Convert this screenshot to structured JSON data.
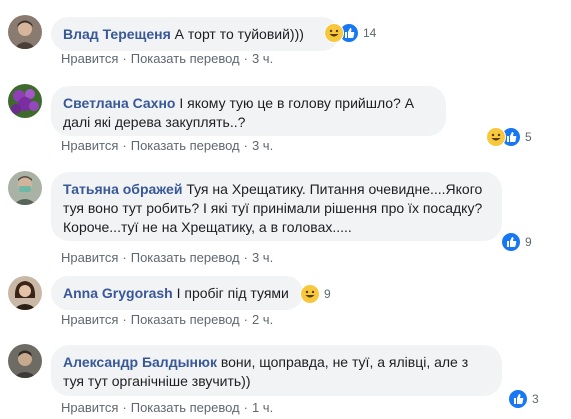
{
  "comments": [
    {
      "author": "Влад Терещеня",
      "text": "А торт то туйовий)))",
      "reaction_count": "14",
      "reactions": [
        "haha-icon",
        "like-icon"
      ],
      "actions": {
        "like": "Нравится",
        "translate": "Показать перевод",
        "time": "3 ч."
      }
    },
    {
      "author": "Светлана Сахно",
      "text": "І якому тую це в голову прийшло? А далі які дерева закуплять..?",
      "reaction_count": "5",
      "reactions": [
        "haha-icon",
        "like-icon"
      ],
      "actions": {
        "like": "Нравится",
        "translate": "Показать перевод",
        "time": "3 ч."
      }
    },
    {
      "author": "Татьяна ображей",
      "text": "Туя на Хрещатику. Питання очевидне....Якого туя воно тут робить? І які туї принімали рішення про їх посадку? Короче...туї не на Хрещатику, а в головах.....",
      "reaction_count": "9",
      "reactions": [
        "like-icon"
      ],
      "actions": {
        "like": "Нравится",
        "translate": "Показать перевод",
        "time": "3 ч."
      }
    },
    {
      "author": "Anna Grygorash",
      "text": "І пробіг під туями",
      "reaction_count": "9",
      "reactions": [
        "haha-icon"
      ],
      "actions": {
        "like": "Нравится",
        "translate": "Показать перевод",
        "time": "2 ч."
      }
    },
    {
      "author": "Александр Балдынюк",
      "text": "вони, щоправда, не туї, а ялівці, але з туя тут органічніше звучить))",
      "reaction_count": "3",
      "reactions": [
        "like-icon"
      ],
      "actions": {
        "like": "Нравится",
        "translate": "Показать перевод",
        "time": "1 ч."
      }
    }
  ],
  "separator": "·",
  "colors": {
    "author": "#385898",
    "bubble": "#f2f3f5",
    "meta": "#606770",
    "like": "#1877f2",
    "haha": "#f7c83e"
  }
}
